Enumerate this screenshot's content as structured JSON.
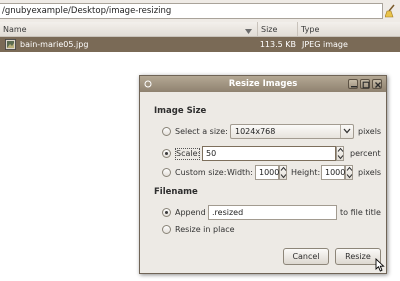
{
  "location": {
    "path": "/gnubyexample/Desktop/image-resizing"
  },
  "columns": {
    "name": "Name",
    "size": "Size",
    "type": "Type"
  },
  "files": [
    {
      "name": "bain-marie05.jpg",
      "size": "113.5 KB",
      "type": "JPEG image",
      "selected": true
    }
  ],
  "dialog": {
    "title": "Resize Images",
    "image_size": {
      "heading": "Image Size",
      "select_size_label": "Select a size:",
      "select_size_value": "1024x768",
      "select_size_unit": "pixels",
      "scale_label": "Scale:",
      "scale_value": "50",
      "scale_unit": "percent",
      "custom_label": "Custom size:",
      "width_label": "Width:",
      "width_value": "1000",
      "height_label": "Height:",
      "height_value": "1000",
      "custom_unit": "pixels",
      "selected_option": "scale"
    },
    "filename": {
      "heading": "Filename",
      "append_label": "Append",
      "append_value": ".resized",
      "append_suffix": "to file title",
      "in_place_label": "Resize in place",
      "selected_option": "append"
    },
    "buttons": {
      "cancel": "Cancel",
      "resize": "Resize"
    }
  },
  "colors": {
    "selection": "#7a6a56",
    "titlebar": "#a09380",
    "dialog_bg": "#edeae5"
  },
  "icons": [
    "clear-icon",
    "image-file-icon",
    "sort-arrow-icon",
    "window-menu-icon",
    "minimize-icon",
    "maximize-icon",
    "close-icon",
    "chevron-down-icon",
    "spin-up-icon",
    "spin-down-icon",
    "mouse-cursor-icon"
  ]
}
